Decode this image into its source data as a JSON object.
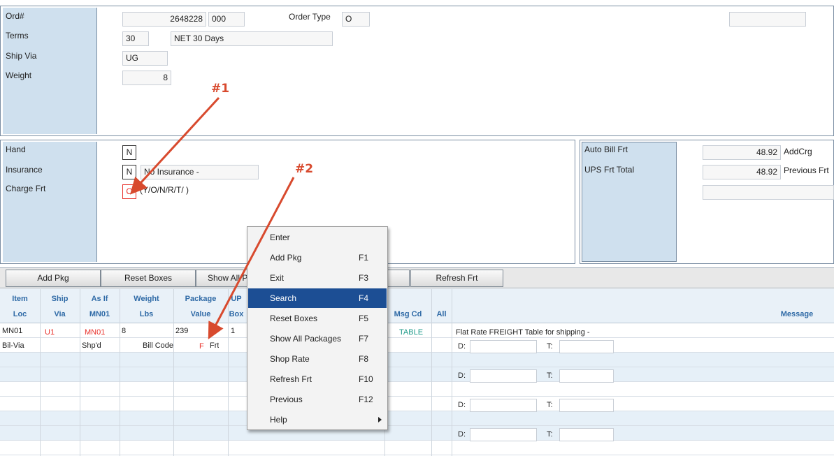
{
  "order": {
    "labels": {
      "ord": "Ord#",
      "terms": "Terms",
      "ship_via": "Ship Via",
      "weight": "Weight",
      "order_type": "Order Type"
    },
    "values": {
      "ord_no": "2648228",
      "ord_suffix": "000",
      "order_type": "O",
      "terms_code": "30",
      "terms_desc": "NET 30 Days",
      "ship_via": "UG",
      "weight": "8"
    }
  },
  "charges": {
    "labels": {
      "hand": "Hand",
      "insurance": "Insurance",
      "charge_frt": "Charge Frt",
      "charge_frt_hint": "(Y/O/N/R/T/ )"
    },
    "values": {
      "hand": "N",
      "insurance": "N",
      "insurance_desc": "No Insurance -",
      "charge_frt": "O"
    }
  },
  "freight": {
    "labels": {
      "auto_bill_frt": "Auto Bill Frt",
      "ups_frt_total": "UPS Frt Total",
      "add_crg": "AddCrg",
      "previous_frt": "Previous Frt"
    },
    "values": {
      "auto_bill_frt": "48.92",
      "ups_frt_total": "48.92"
    }
  },
  "toolbar": {
    "add_pkg": "Add Pkg",
    "reset_boxes": "Reset Boxes",
    "show_all": "Show All Packages",
    "refresh_frt": "Refresh Frt"
  },
  "grid": {
    "headers": {
      "item": "Item",
      "loc": "Loc",
      "ship": "Ship",
      "via": "Via",
      "as_if": "As If",
      "mn01": "MN01",
      "weight": "Weight",
      "lbs": "Lbs",
      "package": "Package",
      "value": "Value",
      "up": "UP",
      "box": "Box",
      "msg_cd": "Msg Cd",
      "all": "All",
      "message": "Message"
    },
    "row1": {
      "loc": "MN01",
      "via": "U1",
      "as_if": "MN01",
      "weight": "8",
      "value": "239",
      "box": "1",
      "msg_cd": "TABLE",
      "message": "Flat Rate FREIGHT Table for shipping -"
    },
    "row2": {
      "bill_via": "Bil-Via",
      "shpd": "Shp'd",
      "bill_code": "Bill Code",
      "code": "F",
      "frt": "Frt"
    },
    "d_label": "D:",
    "t_label": "T:"
  },
  "context_menu": {
    "items": [
      {
        "label": "Enter",
        "key": ""
      },
      {
        "label": "Add Pkg",
        "key": "F1"
      },
      {
        "label": "Exit",
        "key": "F3"
      },
      {
        "label": "Search",
        "key": "F4"
      },
      {
        "label": "Reset Boxes",
        "key": "F5"
      },
      {
        "label": "Show All Packages",
        "key": "F7"
      },
      {
        "label": "Shop Rate",
        "key": "F8"
      },
      {
        "label": "Refresh Frt",
        "key": "F10"
      },
      {
        "label": "Previous",
        "key": "F12"
      },
      {
        "label": "Help",
        "key": ""
      }
    ],
    "submenu_arrow_icon": "chevron-right-icon"
  },
  "annotations": {
    "a1": "#1",
    "a2": "#2",
    "color": "#d84a2e"
  },
  "colors": {
    "label_panel": "#cfe0ee",
    "menu_highlight": "#1c4e94",
    "header_text": "#2f6aa6",
    "red_text": "#e8302a",
    "alt_row": "#e6f0f8"
  }
}
